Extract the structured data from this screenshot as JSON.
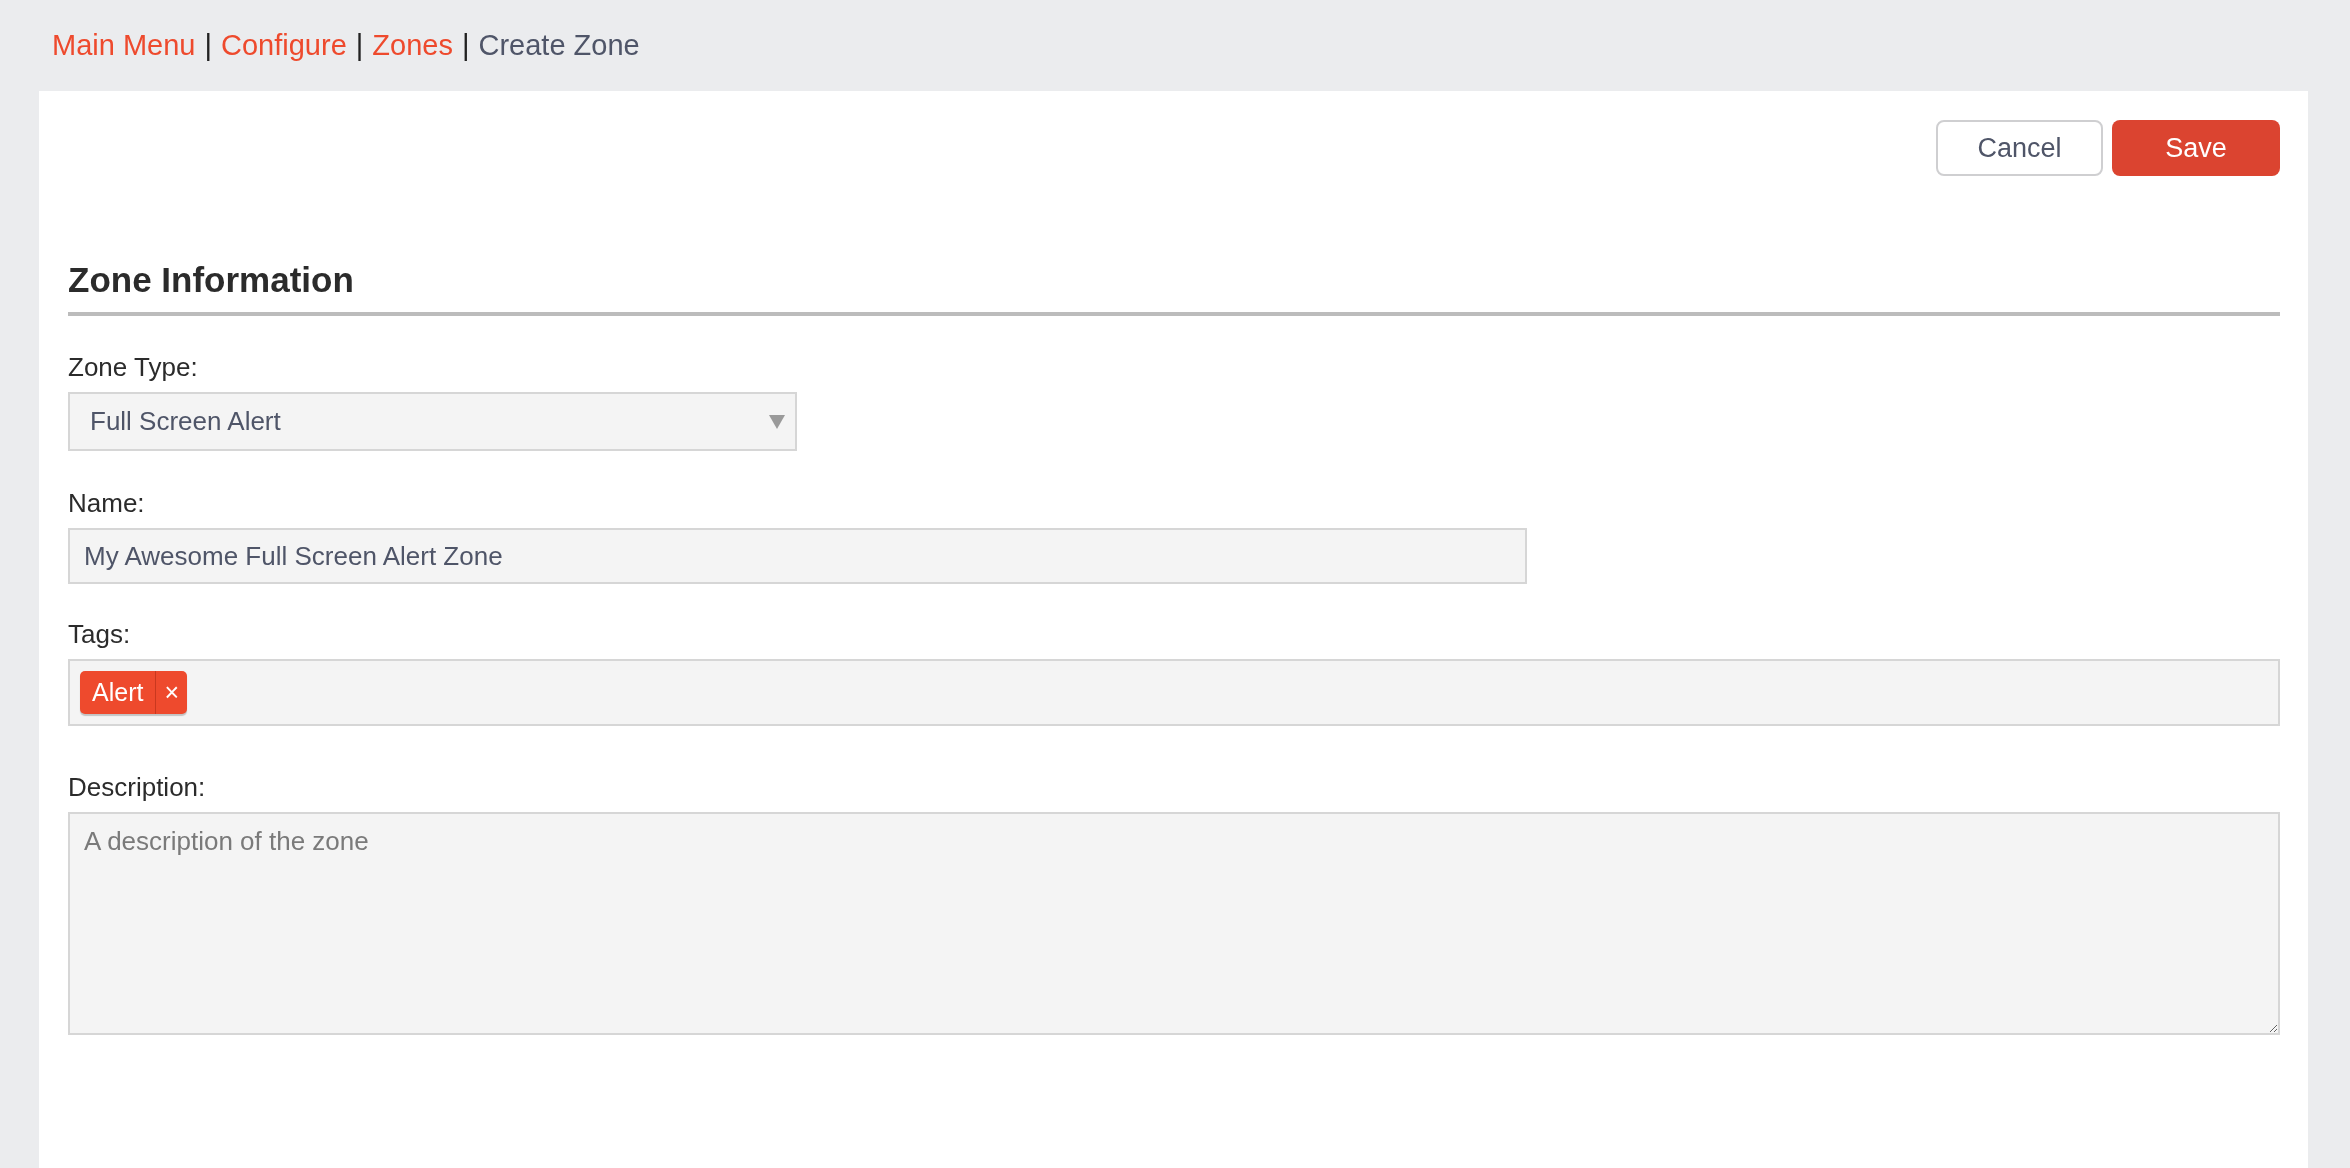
{
  "breadcrumb": [
    {
      "kind": "link",
      "label": "Main Menu"
    },
    {
      "kind": "separator",
      "label": "|"
    },
    {
      "kind": "link",
      "label": "Configure"
    },
    {
      "kind": "separator",
      "label": "|"
    },
    {
      "kind": "link",
      "label": "Zones"
    },
    {
      "kind": "separator",
      "label": "|"
    },
    {
      "kind": "current",
      "label": "Create Zone"
    }
  ],
  "actions": [
    {
      "kind": "secondary",
      "label": "Cancel"
    },
    {
      "kind": "primary",
      "label": "Save"
    }
  ],
  "section": {
    "title": "Zone Information"
  },
  "fields": [
    {
      "kind": "select",
      "label": "Zone Type:",
      "value": "Full Screen Alert"
    },
    {
      "kind": "text",
      "label": "Name:",
      "value": "My Awesome Full Screen Alert Zone"
    },
    {
      "kind": "tags",
      "label": "Tags:",
      "tags": [
        {
          "label": "Alert",
          "remove": "×"
        }
      ]
    },
    {
      "kind": "textarea",
      "label": "Description:",
      "placeholder": "A description of the zone"
    }
  ]
}
